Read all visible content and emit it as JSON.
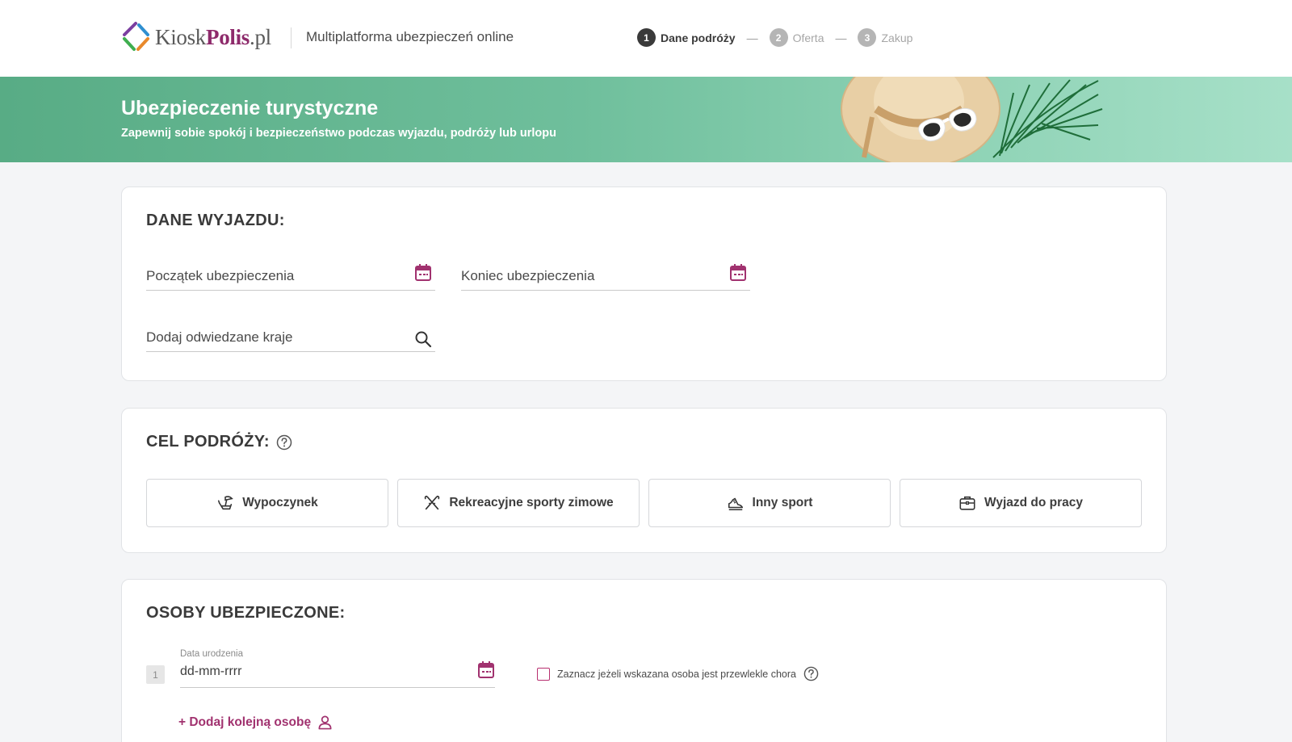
{
  "header": {
    "logo_prefix": "Kiosk",
    "logo_brand": "Polis",
    "logo_suffix": ".pl",
    "tagline": "Multiplatforma ubezpieczeń online",
    "steps": [
      {
        "num": "1",
        "label": "Dane podróży",
        "active": true
      },
      {
        "num": "2",
        "label": "Oferta",
        "active": false
      },
      {
        "num": "3",
        "label": "Zakup",
        "active": false
      }
    ],
    "step_separator": "—"
  },
  "banner": {
    "title": "Ubezpieczenie turystyczne",
    "subtitle": "Zapewnij sobie spokój i bezpieczeństwo podczas wyjazdu, podróży lub urlopu"
  },
  "trip": {
    "title": "DANE WYJAZDU:",
    "start_label": "Początek ubezpieczenia",
    "end_label": "Koniec ubezpieczenia",
    "countries_label": "Dodaj odwiedzane kraje"
  },
  "purpose": {
    "title": "CEL PODRÓŻY:",
    "options": [
      {
        "label": "Wypoczynek",
        "icon": "beach-chair-icon"
      },
      {
        "label": "Rekreacyjne sporty zimowe",
        "icon": "skis-icon"
      },
      {
        "label": "Inny sport",
        "icon": "sneaker-icon"
      },
      {
        "label": "Wyjazd do pracy",
        "icon": "briefcase-icon"
      }
    ]
  },
  "insured": {
    "title": "OSOBY UBEZPIECZONE:",
    "person_number": "1",
    "dob_label": "Data urodzenia",
    "dob_value": "dd-mm-rrrr",
    "chronic_label": "Zaznacz jeżeli wskazana osoba jest przewlekle chora",
    "add_person_label": "+ Dodaj kolejną osobę"
  },
  "colors": {
    "brand": "#8e2a6b",
    "accent": "#a1326f",
    "banner_start": "#58ac85",
    "banner_end": "#a7e0c8"
  }
}
